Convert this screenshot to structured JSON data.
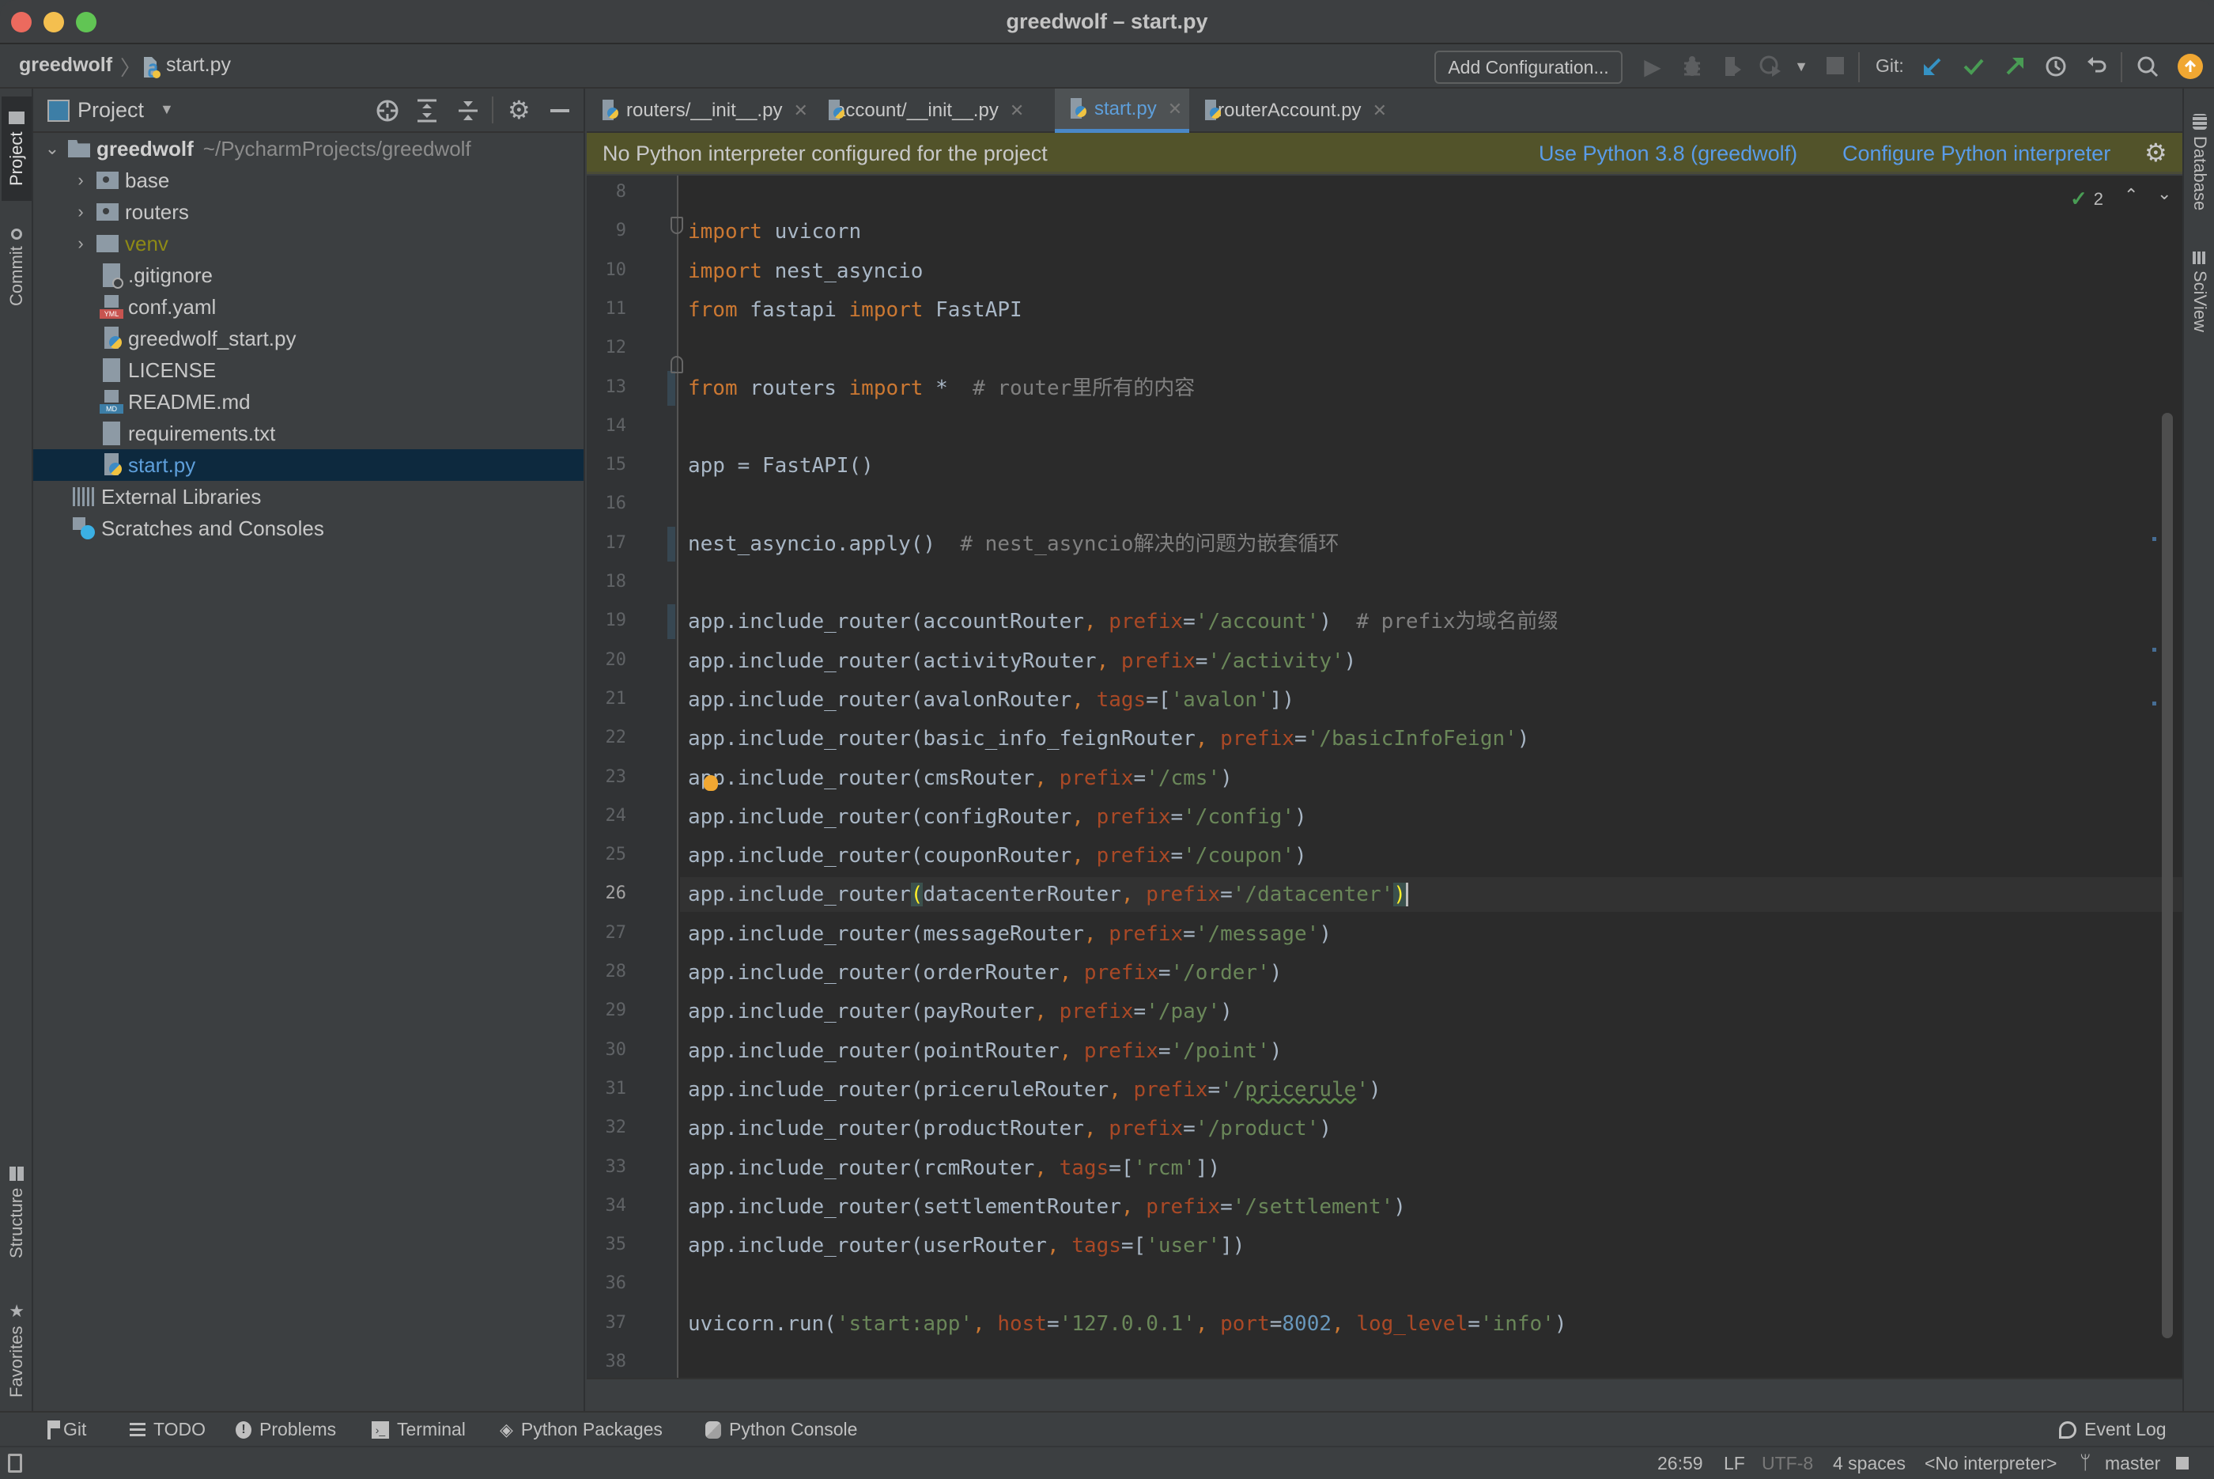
{
  "window": {
    "title": "greedwolf – start.py",
    "traffic_colors": [
      "#ec6a5e",
      "#f4bf4f",
      "#61c554"
    ]
  },
  "navbar": {
    "breadcrumb_root": "greedwolf",
    "breadcrumb_sep": "〉",
    "breadcrumb_file": "start.py",
    "add_configuration": "Add Configuration...",
    "git_label": "Git:"
  },
  "left_strip": {
    "project": "Project",
    "commit": "Commit",
    "structure": "Structure",
    "favorites": "Favorites"
  },
  "right_strip": {
    "database": "Database",
    "sciview": "SciView"
  },
  "project_panel": {
    "title": "Project",
    "root_name": "greedwolf",
    "root_path": "~/PycharmProjects/greedwolf",
    "items": [
      {
        "label": "base",
        "type": "folder"
      },
      {
        "label": "routers",
        "type": "folder"
      },
      {
        "label": "venv",
        "type": "folder-excluded"
      },
      {
        "label": ".gitignore",
        "type": "gitignore"
      },
      {
        "label": "conf.yaml",
        "type": "yaml"
      },
      {
        "label": "greedwolf_start.py",
        "type": "python"
      },
      {
        "label": "LICENSE",
        "type": "text"
      },
      {
        "label": "README.md",
        "type": "markdown"
      },
      {
        "label": "requirements.txt",
        "type": "text"
      },
      {
        "label": "start.py",
        "type": "python",
        "selected": true
      }
    ],
    "external_libraries": "External Libraries",
    "scratches": "Scratches and Consoles"
  },
  "tabs": [
    {
      "label": "routers/__init__.py",
      "active": false
    },
    {
      "label": "account/__init__.py",
      "active": false
    },
    {
      "label": "start.py",
      "active": true
    },
    {
      "label": "routerAccount.py",
      "active": false
    }
  ],
  "tab_close": "✕",
  "notification": {
    "message": "No Python interpreter configured for the project",
    "link_use": "Use Python 3.8 (greedwolf)",
    "link_configure": "Configure Python interpreter"
  },
  "editor": {
    "inspection_count": "2",
    "current_line": 26,
    "lines": [
      {
        "n": "8",
        "html": ""
      },
      {
        "n": "9",
        "html": "<span class=\"kw\">import</span> uvicorn"
      },
      {
        "n": "10",
        "html": "<span class=\"kw\">import</span> nest_asyncio"
      },
      {
        "n": "11",
        "html": "<span class=\"kw\">from</span> fastapi <span class=\"kw\">import</span> FastAPI"
      },
      {
        "n": "12",
        "html": ""
      },
      {
        "n": "13",
        "html": "<span class=\"kw\">from</span> routers <span class=\"kw\">import</span> *  <span class=\"cmt\"># router里所有的内容</span>"
      },
      {
        "n": "14",
        "html": ""
      },
      {
        "n": "15",
        "html": "app = FastAPI()"
      },
      {
        "n": "16",
        "html": ""
      },
      {
        "n": "17",
        "html": "nest_asyncio.apply()  <span class=\"cmt\"># nest_asyncio解决的问题为嵌套循环</span>"
      },
      {
        "n": "18",
        "html": ""
      },
      {
        "n": "19",
        "html": "app.include_router(accountRouter<span class=\"comma\">,</span> <span class=\"kwarg\">prefix</span>=<span class=\"str\">'/account'</span>)  <span class=\"cmt\"># prefix为域名前缀</span>"
      },
      {
        "n": "20",
        "html": "app.include_router(activityRouter<span class=\"comma\">,</span> <span class=\"kwarg\">prefix</span>=<span class=\"str\">'/activity'</span>)"
      },
      {
        "n": "21",
        "html": "app.include_router(avalonRouter<span class=\"comma\">,</span> <span class=\"kwarg\">tags</span>=[<span class=\"str\">'avalon'</span>])"
      },
      {
        "n": "22",
        "html": "app.include_router(basic_info_feignRouter<span class=\"comma\">,</span> <span class=\"kwarg\">prefix</span>=<span class=\"str\">'/basicInfoFeign'</span>)"
      },
      {
        "n": "23",
        "html": "app.include_router(cmsRouter<span class=\"comma\">,</span> <span class=\"kwarg\">prefix</span>=<span class=\"str\">'/cms'</span>)"
      },
      {
        "n": "24",
        "html": "app.include_router(configRouter<span class=\"comma\">,</span> <span class=\"kwarg\">prefix</span>=<span class=\"str\">'/config'</span>)"
      },
      {
        "n": "25",
        "html": "app.include_router(couponRouter<span class=\"comma\">,</span> <span class=\"kwarg\">prefix</span>=<span class=\"str\">'/coupon'</span>)"
      },
      {
        "n": "26",
        "html": "app.include_router<span style=\"color:#ffef28;background:#3b514d\">(</span>datacenterRouter<span class=\"comma\">,</span> <span class=\"kwarg\">prefix</span>=<span class=\"str\">'/datacenter'</span><span style=\"color:#ffef28;background:#3b514d\">)</span><span style=\"border-left:3px solid #bbb\"></span>"
      },
      {
        "n": "27",
        "html": "app.include_router(messageRouter<span class=\"comma\">,</span> <span class=\"kwarg\">prefix</span>=<span class=\"str\">'/message'</span>)"
      },
      {
        "n": "28",
        "html": "app.include_router(orderRouter<span class=\"comma\">,</span> <span class=\"kwarg\">prefix</span>=<span class=\"str\">'/order'</span>)"
      },
      {
        "n": "29",
        "html": "app.include_router(payRouter<span class=\"comma\">,</span> <span class=\"kwarg\">prefix</span>=<span class=\"str\">'/pay'</span>)"
      },
      {
        "n": "30",
        "html": "app.include_router(pointRouter<span class=\"comma\">,</span> <span class=\"kwarg\">prefix</span>=<span class=\"str\">'/point'</span>)"
      },
      {
        "n": "31",
        "html": "app.include_router(priceruleRouter<span class=\"comma\">,</span> <span class=\"kwarg\">prefix</span>=<span class=\"str\">'/<span style=\"text-decoration:underline wavy #5f8c4b\">pricerule</span>'</span>)"
      },
      {
        "n": "32",
        "html": "app.include_router(productRouter<span class=\"comma\">,</span> <span class=\"kwarg\">prefix</span>=<span class=\"str\">'/product'</span>)"
      },
      {
        "n": "33",
        "html": "app.include_router(rcmRouter<span class=\"comma\">,</span> <span class=\"kwarg\">tags</span>=[<span class=\"str\">'rcm'</span>])"
      },
      {
        "n": "34",
        "html": "app.include_router(settlementRouter<span class=\"comma\">,</span> <span class=\"kwarg\">prefix</span>=<span class=\"str\">'/settlement'</span>)"
      },
      {
        "n": "35",
        "html": "app.include_router(userRouter<span class=\"comma\">,</span> <span class=\"kwarg\">tags</span>=[<span class=\"str\">'user'</span>])"
      },
      {
        "n": "36",
        "html": ""
      },
      {
        "n": "37",
        "html": "uvicorn.run(<span class=\"str\">'start:app'</span><span class=\"comma\">,</span> <span class=\"kwarg\">host</span>=<span class=\"str\">'127.0.0.1'</span><span class=\"comma\">,</span> <span class=\"kwarg\">port</span>=<span class=\"num\">8002</span><span class=\"comma\">,</span> <span class=\"kwarg\">log_level</span>=<span class=\"str\">'info'</span>)"
      },
      {
        "n": "38",
        "html": ""
      }
    ]
  },
  "bottom_tools": [
    {
      "label": "Git",
      "icon": "git-icon"
    },
    {
      "label": "TODO",
      "icon": "todo-icon"
    },
    {
      "label": "Problems",
      "icon": "problems-icon"
    },
    {
      "label": "Terminal",
      "icon": "terminal-icon"
    },
    {
      "label": "Python Packages",
      "icon": "packages-icon"
    },
    {
      "label": "Python Console",
      "icon": "python-console-icon"
    }
  ],
  "event_log": "Event Log",
  "status": {
    "position": "26:59",
    "line_sep": "LF",
    "encoding": "UTF-8",
    "indent": "4 spaces",
    "interpreter": "<No interpreter>",
    "branch": "master"
  },
  "colors": {
    "accent": "#4a88c7",
    "notification_bg": "#52532a",
    "link": "#5a9ce8",
    "selection": "#0d293e",
    "update_badge": "#f0a732"
  }
}
